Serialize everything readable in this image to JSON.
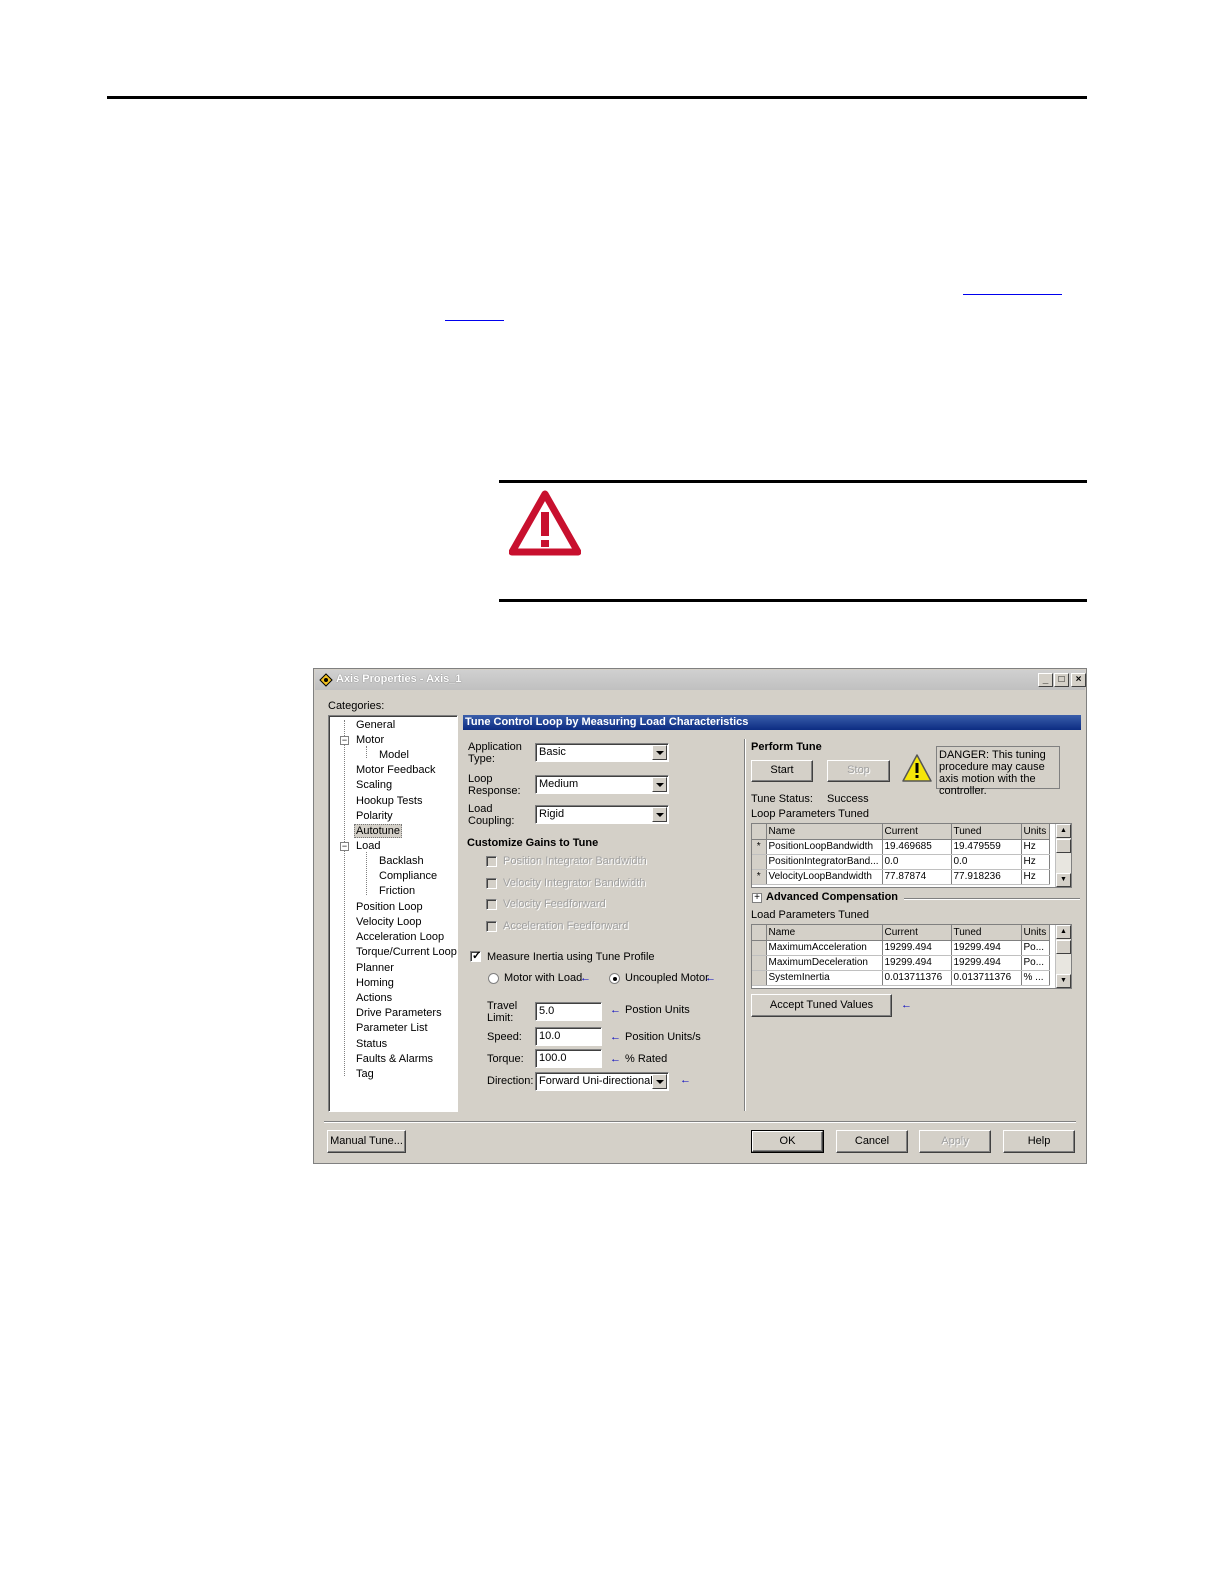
{
  "dialog": {
    "title": "Axis Properties - Axis_1",
    "window_buttons": {
      "minimize": "_",
      "maximize": "□",
      "close": "×"
    },
    "categories_label": "Categories:",
    "tree": [
      {
        "label": "General"
      },
      {
        "label": "Motor"
      },
      {
        "label": "Model"
      },
      {
        "label": "Motor Feedback"
      },
      {
        "label": "Scaling"
      },
      {
        "label": "Hookup Tests"
      },
      {
        "label": "Polarity"
      },
      {
        "label": "Autotune"
      },
      {
        "label": "Load"
      },
      {
        "label": "Backlash"
      },
      {
        "label": "Compliance"
      },
      {
        "label": "Friction"
      },
      {
        "label": "Position Loop"
      },
      {
        "label": "Velocity Loop"
      },
      {
        "label": "Acceleration Loop"
      },
      {
        "label": "Torque/Current Loop"
      },
      {
        "label": "Planner"
      },
      {
        "label": "Homing"
      },
      {
        "label": "Actions"
      },
      {
        "label": "Drive Parameters"
      },
      {
        "label": "Parameter List"
      },
      {
        "label": "Status"
      },
      {
        "label": "Faults & Alarms"
      },
      {
        "label": "Tag"
      }
    ],
    "tree_selected": "Autotune",
    "panel_header": "Tune Control Loop by Measuring Load Characteristics",
    "application_type": {
      "label_line1": "Application",
      "label_line2": "Type:",
      "value": "Basic"
    },
    "loop_response": {
      "label_line1": "Loop",
      "label_line2": "Response:",
      "value": "Medium"
    },
    "load_coupling": {
      "label_line1": "Load",
      "label_line2": "Coupling:",
      "value": "Rigid"
    },
    "customize_heading": "Customize Gains to Tune",
    "gain_options": [
      "Position Integrator Bandwidth",
      "Velocity Integrator Bandwidth",
      "Velocity Feedforward",
      "Acceleration Feedforward"
    ],
    "measure_inertia": {
      "label": "Measure Inertia using Tune Profile",
      "checked": true
    },
    "radio_motor_with_load": "Motor with Load",
    "radio_uncoupled_motor": "Uncoupled Motor",
    "radio_selected": "Uncoupled Motor",
    "travel_limit": {
      "label_line1": "Travel",
      "label_line2": "Limit:",
      "value": "5.0",
      "units": "Postion Units"
    },
    "speed": {
      "label": "Speed:",
      "value": "10.0",
      "units": "Position Units/s"
    },
    "torque": {
      "label": "Torque:",
      "value": "100.0",
      "units": "% Rated"
    },
    "direction": {
      "label": "Direction:",
      "value": "Forward Uni-directional"
    },
    "perform_tune": {
      "heading": "Perform Tune",
      "start": "Start",
      "stop": "Stop",
      "danger_text": "DANGER: This tuning procedure may cause axis motion with the controller.",
      "tune_status_label": "Tune Status:",
      "tune_status_value": "Success"
    },
    "loop_params": {
      "heading": "Loop Parameters Tuned",
      "columns": [
        "Name",
        "Current",
        "Tuned",
        "Units"
      ],
      "rows": [
        {
          "mark": "*",
          "name": "PositionLoopBandwidth",
          "current": "19.469685",
          "tuned": "19.479559",
          "units": "Hz"
        },
        {
          "mark": "",
          "name": "PositionIntegratorBand...",
          "current": "0.0",
          "tuned": "0.0",
          "units": "Hz"
        },
        {
          "mark": "*",
          "name": "VelocityLoopBandwidth",
          "current": "77.87874",
          "tuned": "77.918236",
          "units": "Hz"
        }
      ]
    },
    "advanced_compensation": "Advanced Compensation",
    "load_params": {
      "heading": "Load Parameters Tuned",
      "columns": [
        "Name",
        "Current",
        "Tuned",
        "Units"
      ],
      "rows": [
        {
          "mark": "",
          "name": "MaximumAcceleration",
          "current": "19299.494",
          "tuned": "19299.494",
          "units": "Po..."
        },
        {
          "mark": "",
          "name": "MaximumDeceleration",
          "current": "19299.494",
          "tuned": "19299.494",
          "units": "Po..."
        },
        {
          "mark": "",
          "name": "SystemInertia",
          "current": "0.013711376",
          "tuned": "0.013711376",
          "units": "% ..."
        }
      ]
    },
    "accept_tuned_values": "Accept Tuned Values",
    "footer": {
      "manual_tune": "Manual Tune...",
      "ok": "OK",
      "cancel": "Cancel",
      "apply": "Apply",
      "help": "Help"
    }
  }
}
